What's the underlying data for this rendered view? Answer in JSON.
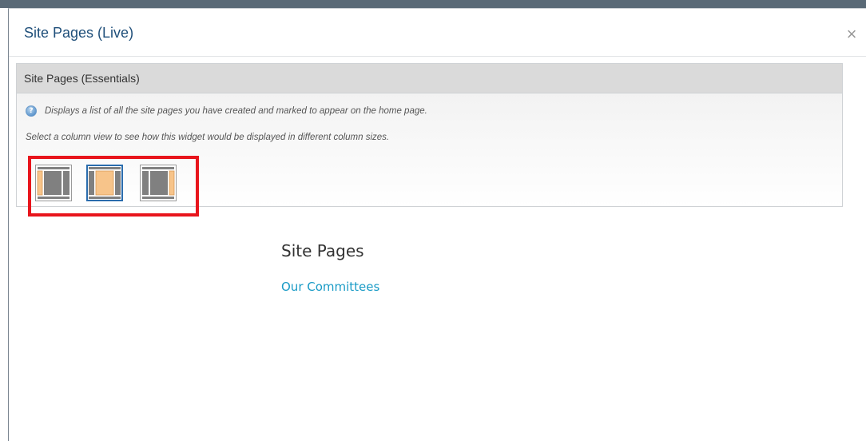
{
  "modal": {
    "title": "Site Pages (Live)",
    "close_label": "×"
  },
  "widget": {
    "header": "Site Pages (Essentials)",
    "description": "Displays a list of all the site pages you have created and marked to appear on the home page.",
    "help_icon_glyph": "?",
    "hint": "Select a column view to see how this widget would be displayed in different column sizes.",
    "column_views": [
      {
        "name": "left-column",
        "selected": false
      },
      {
        "name": "center-column",
        "selected": true
      },
      {
        "name": "right-column",
        "selected": false
      }
    ]
  },
  "content": {
    "title": "Site Pages",
    "links": [
      "Our Committees"
    ]
  },
  "colors": {
    "title_blue": "#1f4f7a",
    "link_blue": "#1a9bc6",
    "highlight_red": "#e8151c",
    "selected_border": "#2a6cad",
    "column_highlight": "#f7c48a"
  },
  "icons": {
    "close": "close-icon",
    "help": "help-icon",
    "column_views": [
      "layout-left-icon",
      "layout-center-icon",
      "layout-right-icon"
    ]
  }
}
